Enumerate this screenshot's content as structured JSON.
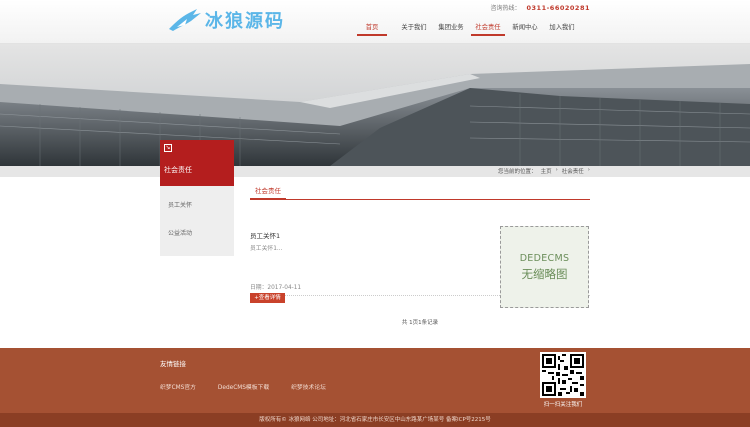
{
  "header": {
    "logo_text": "冰狼源码",
    "hotline_label": "咨询热线：",
    "hotline_number": "0311-66020281"
  },
  "nav": {
    "items": [
      {
        "label": "首页"
      },
      {
        "label": "关于我们"
      },
      {
        "label": "集团业务"
      },
      {
        "label": "社会责任"
      },
      {
        "label": "新闻中心"
      },
      {
        "label": "加入我们"
      }
    ]
  },
  "breadcrumb": {
    "text": "您当前的位置：",
    "home": "主页",
    "sep": "›",
    "current": "社会责任",
    "tail": "›"
  },
  "sidebar": {
    "icon_glyph": "↘",
    "title": "社会责任",
    "items": [
      {
        "label": "员工关怀"
      },
      {
        "label": "公益活动"
      }
    ]
  },
  "main": {
    "tab_label": "社会责任",
    "article": {
      "title": "员工关怀1",
      "summary": "员工关怀1...",
      "date_label": "日期：",
      "date": "2017-04-11",
      "button_label": "+查看详情"
    },
    "thumb": {
      "line1": "DEDECMS",
      "line2": "无缩略图"
    },
    "pager": "共 1页1条记录"
  },
  "footer": {
    "links_title": "友情链接",
    "links": [
      {
        "label": "织梦CMS官方"
      },
      {
        "label": "DedeCMS模板下载"
      },
      {
        "label": "织梦技术论坛"
      }
    ],
    "qr_caption": "扫一扫关注我们",
    "copyright": "版权所有© 冰狼网络    公司地址：河北省石家庄市长安区中山东路某广场某号  备案ICP号2215号"
  },
  "colors": {
    "brand_red": "#c0392b",
    "footer_brown": "#a55133",
    "logo_blue": "#5bb6e8"
  }
}
